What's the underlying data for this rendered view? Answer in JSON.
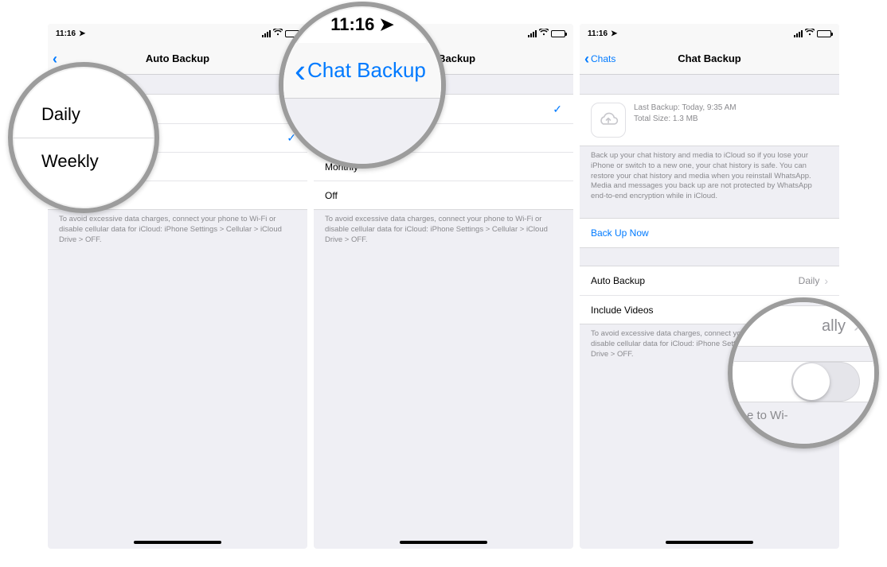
{
  "status": {
    "time": "11:16",
    "location_arrow": "➤"
  },
  "screen1": {
    "nav": {
      "back_label": "",
      "title": "Auto Backup"
    },
    "options": [
      {
        "label": "Daily",
        "checked": false
      },
      {
        "label": "Weekly",
        "checked": true
      },
      {
        "label": "Monthly",
        "checked": false
      },
      {
        "label": "Off",
        "checked": false
      }
    ],
    "footer": "To avoid excessive data charges, connect your phone to Wi-Fi or disable cellular data for iCloud: iPhone Settings > Cellular > iCloud Drive > OFF."
  },
  "screen2": {
    "nav": {
      "back_label": "",
      "title": "Auto Backup"
    },
    "options": [
      {
        "label": "Daily",
        "checked": true
      },
      {
        "label": "Weekly",
        "checked": false
      },
      {
        "label": "Monthly",
        "checked": false
      },
      {
        "label": "Off",
        "checked": false
      }
    ],
    "footer": "To avoid excessive data charges, connect your phone to Wi-Fi or disable cellular data for iCloud: iPhone Settings > Cellular > iCloud Drive > OFF."
  },
  "screen3": {
    "nav": {
      "back_label": "Chats",
      "title": "Chat Backup"
    },
    "info": {
      "last_backup": "Last Backup: Today, 9:35 AM",
      "total_size": "Total Size: 1.3 MB"
    },
    "description": "Back up your chat history and media to iCloud so if you lose your iPhone or switch to a new one, your chat history is safe. You can restore your chat history and media when you reinstall WhatsApp. Media and messages you back up are not protected by WhatsApp end-to-end encryption while in iCloud.",
    "backup_now": "Back Up Now",
    "rows": {
      "auto_backup": {
        "label": "Auto Backup",
        "value": "Daily"
      },
      "include_videos": {
        "label": "Include Videos",
        "value_on": false
      }
    },
    "footer": "To avoid excessive data charges, connect your phone to Wi-Fi or disable cellular data for iCloud: iPhone Settings > Cellular > iCloud Drive > OFF."
  },
  "magnifier1": {
    "row1": "Daily",
    "row2": "Weekly"
  },
  "magnifier2": {
    "time": "11:16",
    "nav_label": "Chat Backup"
  },
  "magnifier3": {
    "top_value_partial": "ally",
    "toggle_on": false,
    "note_partial": "e to Wi-"
  }
}
